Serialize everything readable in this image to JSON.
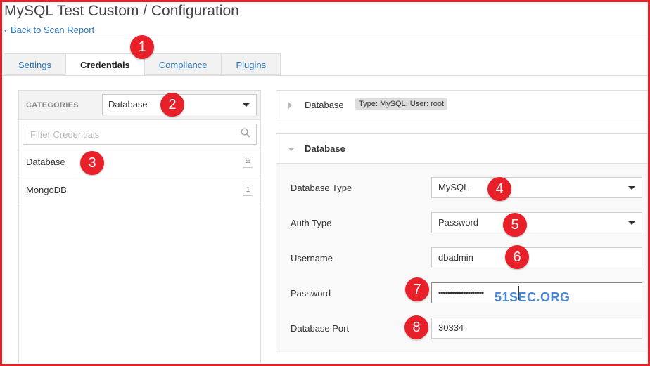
{
  "page": {
    "title": "MySQL Test Custom / Configuration",
    "back_link": "Back to Scan Report"
  },
  "tabs": [
    {
      "label": "Settings",
      "active": false
    },
    {
      "label": "Credentials",
      "active": true
    },
    {
      "label": "Compliance",
      "active": false
    },
    {
      "label": "Plugins",
      "active": false
    }
  ],
  "left_panel": {
    "categories_label": "CATEGORIES",
    "category_selected": "Database",
    "filter_placeholder": "Filter Credentials",
    "items": [
      {
        "label": "Database",
        "count": "∞"
      },
      {
        "label": "MongoDB",
        "count": "1"
      }
    ]
  },
  "summary": {
    "title": "Database",
    "badge": "Type: MySQL, User: root"
  },
  "detail": {
    "title": "Database",
    "fields": {
      "db_type_label": "Database Type",
      "db_type_value": "MySQL",
      "auth_type_label": "Auth Type",
      "auth_type_value": "Password",
      "username_label": "Username",
      "username_value": "dbadmin",
      "password_label": "Password",
      "password_value": "••••••••••••••••••••",
      "port_label": "Database Port",
      "port_value": "30334"
    }
  },
  "annotations": {
    "m1": "1",
    "m2": "2",
    "m3": "3",
    "m4": "4",
    "m5": "5",
    "m6": "6",
    "m7": "7",
    "m8": "8"
  },
  "watermark": "51SEC.ORG",
  "colors": {
    "accent_link": "#2a74b8",
    "marker_red": "#e8202a",
    "frame_red": "#e8202a"
  }
}
